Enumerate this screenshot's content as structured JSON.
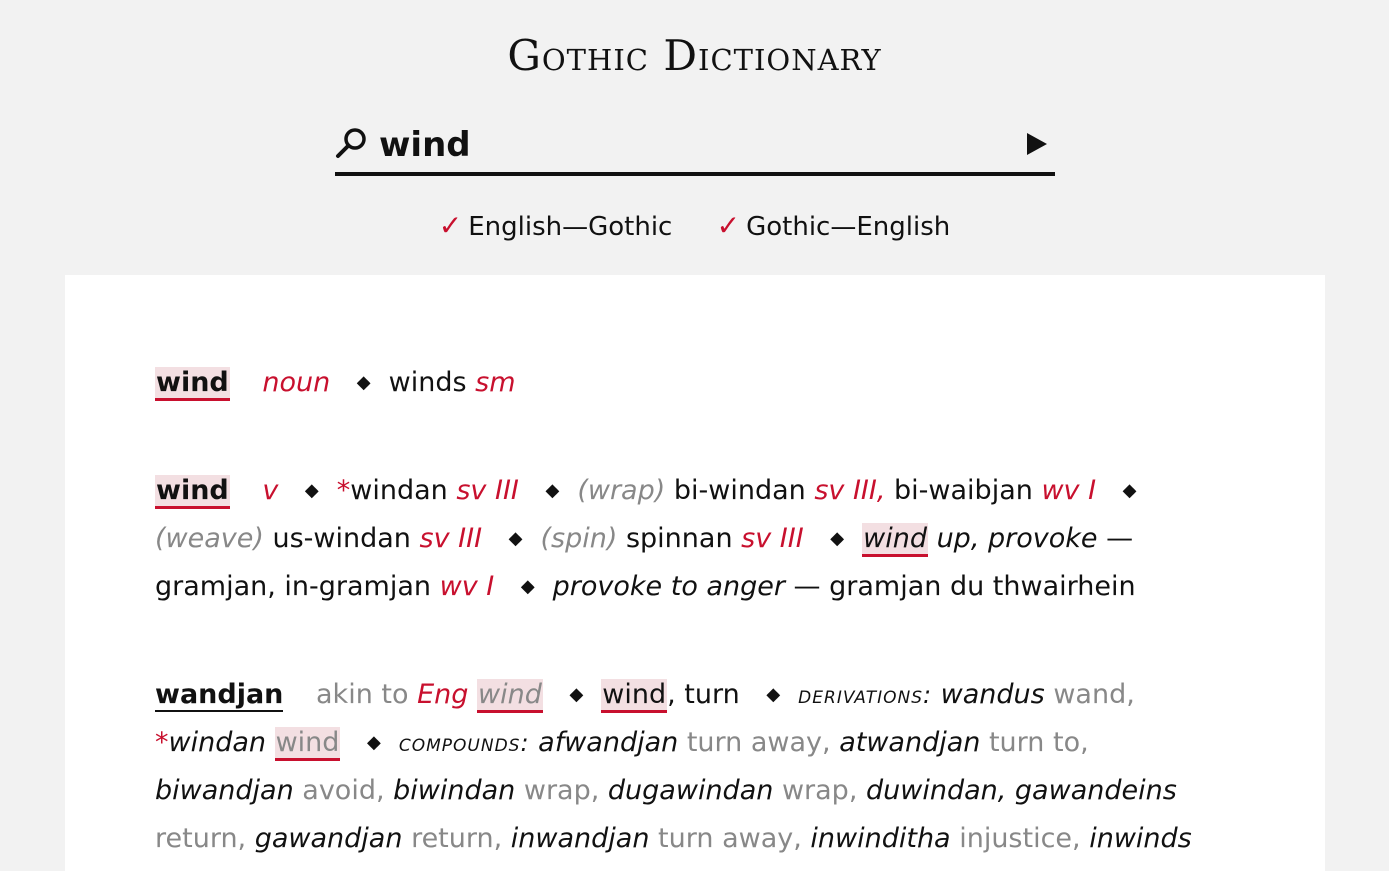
{
  "app": {
    "title": "Gothic Dictionary"
  },
  "search": {
    "value": "wind",
    "icon": "search-icon",
    "submit_icon": "play-icon"
  },
  "toggles": [
    {
      "label": "English—Gothic",
      "checked": true
    },
    {
      "label": "Gothic—English",
      "checked": true
    }
  ],
  "colors": {
    "accent": "#c8102e",
    "highlight_bg": "#f3dfe2",
    "muted": "#888888",
    "page_bg": "#f2f2f2"
  },
  "entries": {
    "e1": {
      "headword": "wind",
      "pos": "noun",
      "gothic": "winds",
      "gothic_class": "sm"
    },
    "e2": {
      "headword": "wind",
      "pos": "v",
      "star": "*",
      "g1": "windan",
      "g1c": "sv III",
      "gl_wrap": "(wrap)",
      "g2": "bi-windan",
      "g2c": "sv III,",
      "g3": "bi-waibjan",
      "g3c": "wv I",
      "gl_weave": "(weave)",
      "g4": "us-windan",
      "g4c": "sv III",
      "gl_spin": "(spin)",
      "g5": "spinnan",
      "g5c": "sv III",
      "hl_wind": "wind",
      "phrase1": "up, provoke",
      "dash1": "—",
      "g6": "gramjan, in-gramjan",
      "g6c": "wv I",
      "phrase2": "provoke to anger",
      "dash2": "—",
      "g7": "gramjan du thwairhein"
    },
    "e3": {
      "headword": "wandjan",
      "akin": "akin to",
      "eng": "Eng",
      "eng_wind": "wind",
      "m_wind": "wind",
      "m_turn": ", turn",
      "derivations_label": "derivations:",
      "d1": "wandus",
      "d1g": "wand,",
      "d2star": "*",
      "d2": "windan",
      "d2g": "wind",
      "compounds_label": "compounds:",
      "c1": "afwandjan",
      "c1g": "turn away,",
      "c2": "atwandjan",
      "c2g": "turn to,",
      "c3": "biwandjan",
      "c3g": "avoid,",
      "c4": "biwindan",
      "c4g": "wrap,",
      "c5": "dugawindan",
      "c5g": "wrap,",
      "c6": "duwindan,",
      "c7": "gawandeins",
      "c7g": "return,",
      "c8": "gawandjan",
      "c8g": "return,",
      "c9": "inwandjan",
      "c9g": "turn away,",
      "c10": "inwinditha",
      "c10g": "injustice,",
      "c11": "inwinds"
    }
  }
}
